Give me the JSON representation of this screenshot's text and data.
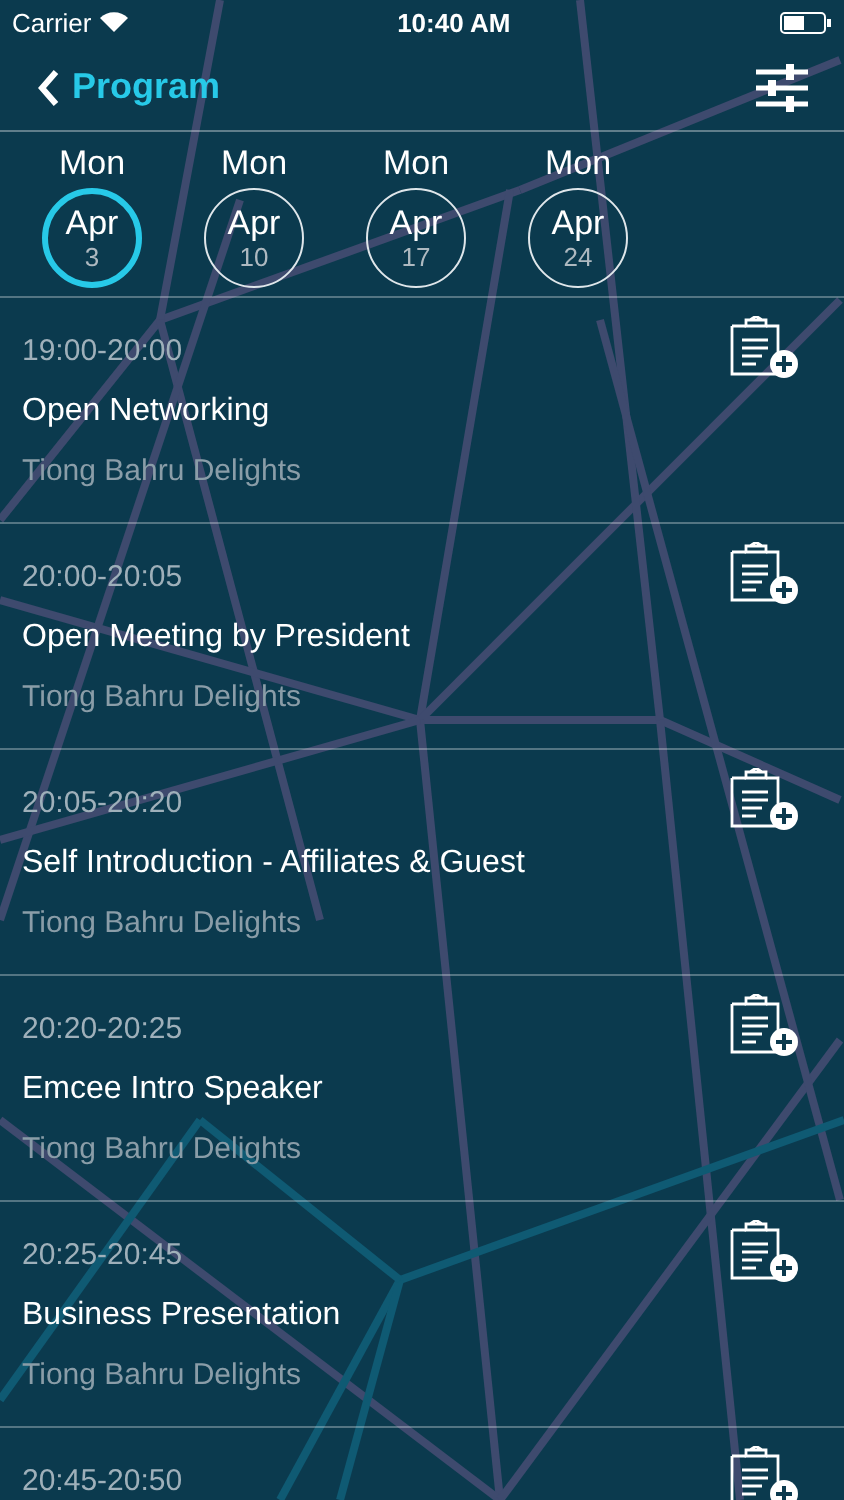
{
  "status_bar": {
    "carrier": "Carrier",
    "time": "10:40 AM"
  },
  "nav": {
    "back_label": "Program"
  },
  "days": [
    {
      "weekday": "Mon",
      "month": "Apr",
      "day": "3",
      "selected": true
    },
    {
      "weekday": "Mon",
      "month": "Apr",
      "day": "10",
      "selected": false
    },
    {
      "weekday": "Mon",
      "month": "Apr",
      "day": "17",
      "selected": false
    },
    {
      "weekday": "Mon",
      "month": "Apr",
      "day": "24",
      "selected": false
    }
  ],
  "sessions": [
    {
      "time": "19:00-20:00",
      "title": "Open Networking",
      "venue": "Tiong Bahru Delights"
    },
    {
      "time": "20:00-20:05",
      "title": "Open Meeting by President",
      "venue": "Tiong Bahru Delights"
    },
    {
      "time": "20:05-20:20",
      "title": "Self Introduction - Affiliates & Guest",
      "venue": "Tiong Bahru Delights"
    },
    {
      "time": "20:20-20:25",
      "title": "Emcee Intro Speaker",
      "venue": "Tiong Bahru Delights"
    },
    {
      "time": "20:25-20:45",
      "title": "Business Presentation",
      "venue": "Tiong Bahru Delights"
    },
    {
      "time": "20:45-20:50"
    }
  ]
}
